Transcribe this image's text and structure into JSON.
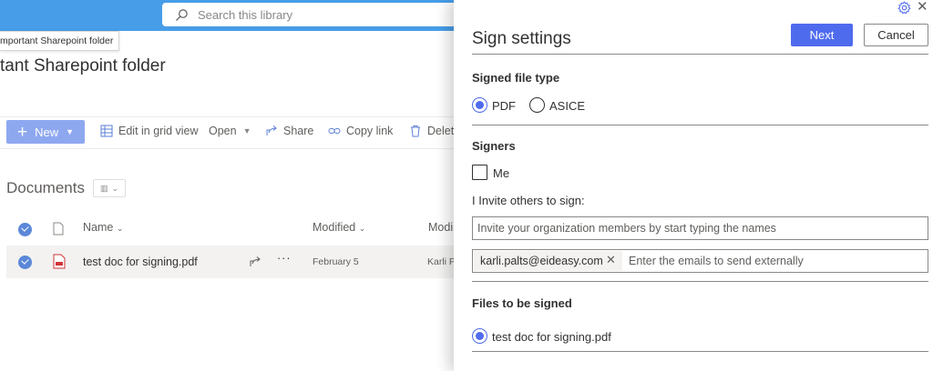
{
  "topbar": {
    "search_placeholder": "Search this library",
    "accent": "#479de8"
  },
  "site": {
    "tooltip": "mportant Sharepoint folder",
    "title": "tant Sharepoint folder"
  },
  "commands": {
    "new_label": "New",
    "edit_grid": "Edit in grid view",
    "open": "Open",
    "share": "Share",
    "copy_link": "Copy link",
    "delete": "Delet"
  },
  "library": {
    "title": "Documents",
    "columns": {
      "name": "Name",
      "modified": "Modified",
      "modified_by": "Modi"
    },
    "rows": [
      {
        "name": "test doc for signing.pdf",
        "modified": "February 5",
        "modified_by": "Karli P"
      }
    ]
  },
  "panel": {
    "title": "Sign settings",
    "next_label": "Next",
    "cancel_label": "Cancel",
    "file_type": {
      "heading": "Signed file type",
      "options": [
        "PDF",
        "ASICE"
      ],
      "selected": "PDF"
    },
    "signers": {
      "heading": "Signers",
      "me_label": "Me",
      "me_checked": false,
      "invite_label": "I Invite others to sign:",
      "org_placeholder": "Invite your organization members by start typing the names",
      "external_chip": "karli.palts@eideasy.com",
      "external_placeholder": "Enter the emails to send externally"
    },
    "files": {
      "heading": "Files to be signed",
      "items": [
        "test doc for signing.pdf"
      ]
    },
    "primary_color": "#4f6bed"
  }
}
